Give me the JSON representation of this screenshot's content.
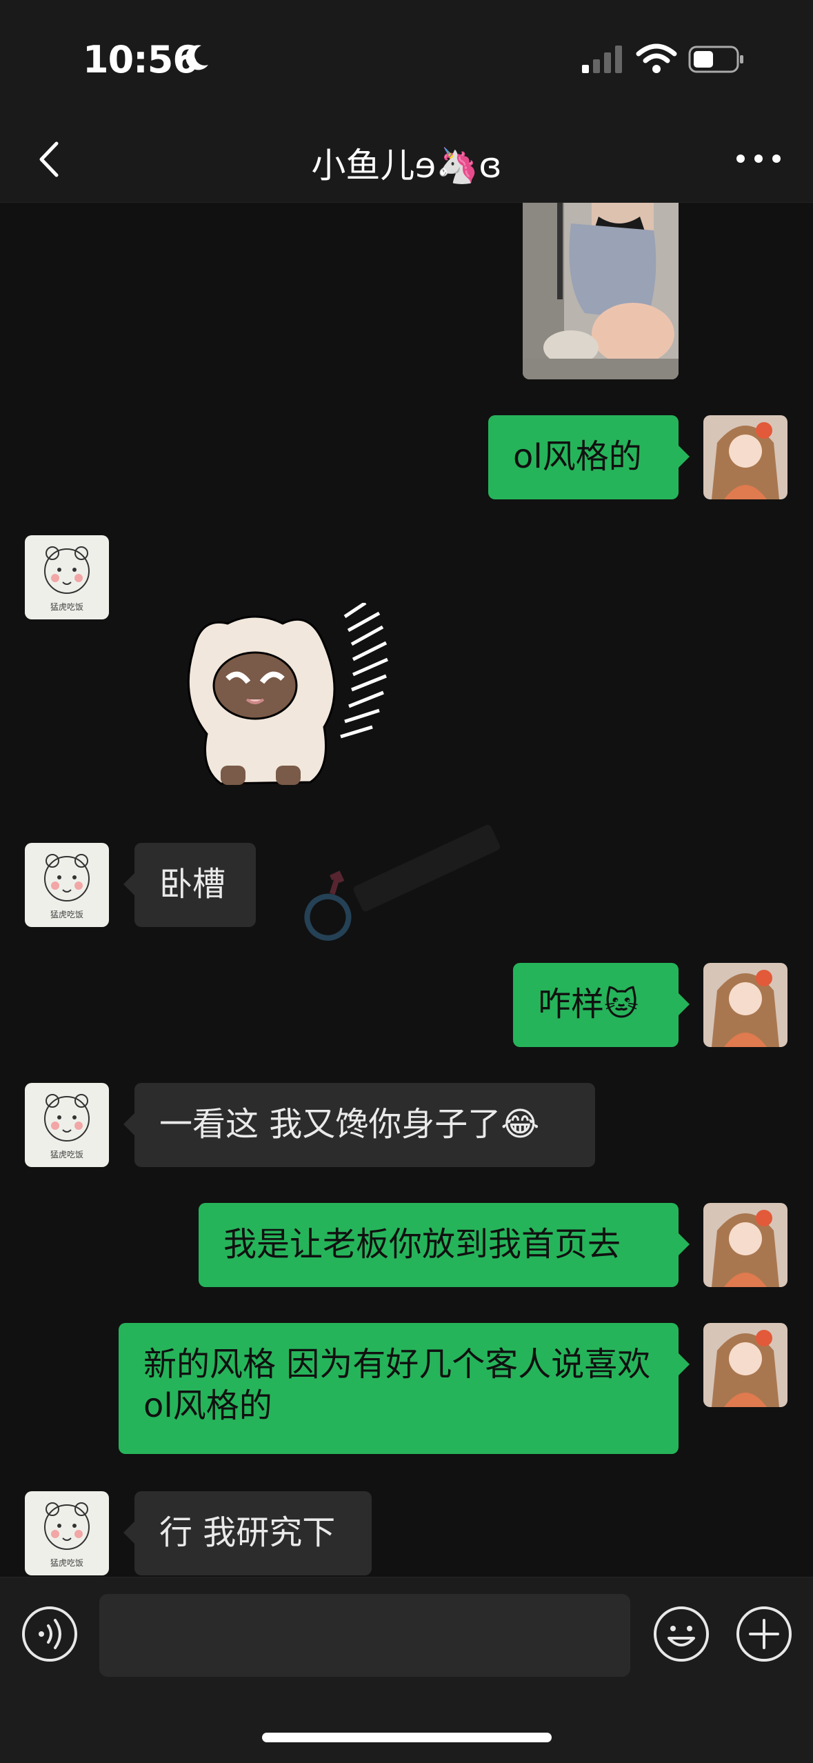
{
  "status_bar": {
    "time": "10:56",
    "icons": [
      "moon-icon",
      "cellular-signal-icon",
      "wifi-icon",
      "battery-icon"
    ]
  },
  "nav": {
    "title": "小鱼儿ɘ🦄ɞ",
    "back_icon": "chevron-left-icon",
    "more_icon": "more-dots-icon"
  },
  "contact_avatar": "bear-sketch-avatar",
  "my_avatar": "anime-girl-avatar",
  "messages": [
    {
      "side": "out",
      "kind": "image",
      "desc": "photo"
    },
    {
      "side": "out",
      "kind": "text",
      "text": "ol风格的"
    },
    {
      "side": "in",
      "kind": "sticker",
      "desc": "crying-cat-sticker"
    },
    {
      "side": "in",
      "kind": "text",
      "text": "卧槽"
    },
    {
      "side": "out",
      "kind": "text",
      "text": "咋样🐱"
    },
    {
      "side": "in",
      "kind": "text",
      "text": "一看这 我又馋你身子了😂"
    },
    {
      "side": "out",
      "kind": "text",
      "text": "我是让老板你放到我首页去"
    },
    {
      "side": "out",
      "kind": "text",
      "text": "新的风格 因为有好几个客人说喜欢ol风格的"
    },
    {
      "side": "in",
      "kind": "text",
      "text": "行 我研究下"
    }
  ],
  "input_bar": {
    "placeholder": "",
    "voice_icon": "voice-icon",
    "emoji_icon": "emoji-icon",
    "plus_icon": "plus-icon"
  },
  "colors": {
    "background": "#111111",
    "bar": "#1a1a1a",
    "incoming_bubble": "#2c2c2c",
    "outgoing_bubble": "#26b45a"
  }
}
